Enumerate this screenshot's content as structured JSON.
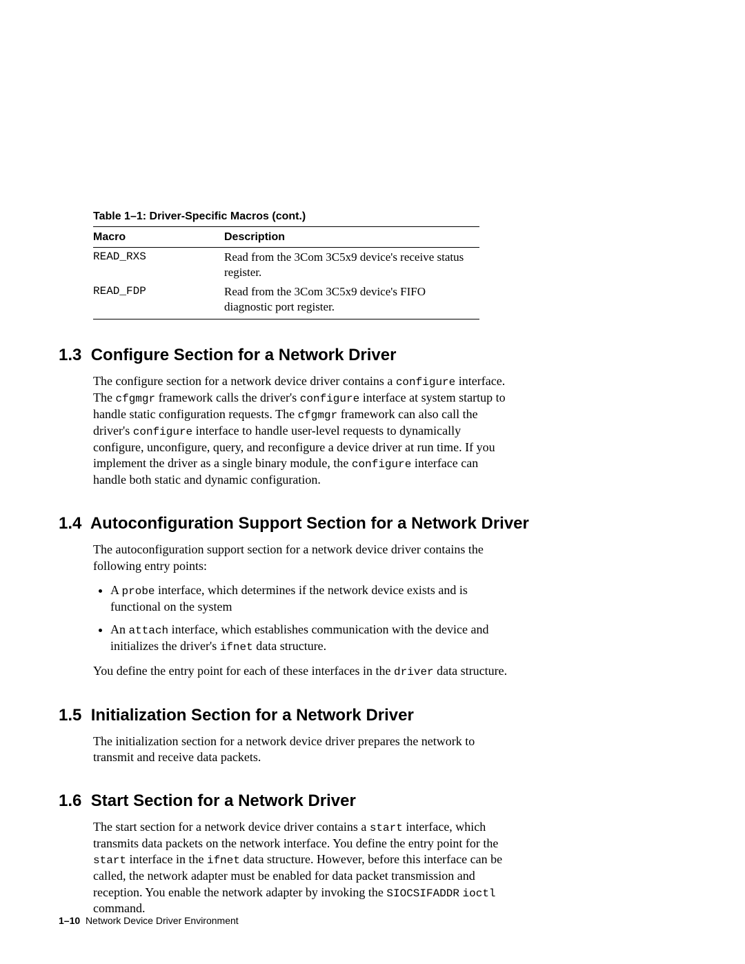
{
  "table": {
    "caption": "Table 1–1: Driver-Specific Macros (cont.)",
    "headers": {
      "c1": "Macro",
      "c2": "Description"
    },
    "rows": [
      {
        "macro": "READ_RXS",
        "desc": "Read from the 3Com 3C5x9 device's receive status register."
      },
      {
        "macro": "READ_FDP",
        "desc": "Read from the 3Com 3C5x9 device's FIFO diagnostic port register."
      }
    ]
  },
  "codes": {
    "configure": "configure",
    "cfgmgr": "cfgmgr",
    "probe": "probe",
    "attach": "attach",
    "ifnet": "ifnet",
    "driver": "driver",
    "start": "start",
    "siocsifaddr": "SIOCSIFADDR",
    "ioctl": "ioctl"
  },
  "sections": {
    "s13": {
      "num": "1.3",
      "title": "Configure Section for a Network Driver",
      "p1a": "The configure section for a network device driver contains a ",
      "p1b": " interface. The ",
      "p1c": " framework calls the driver's ",
      "p1d": " interface at system startup to handle static configuration requests. The ",
      "p1e": " framework can also call the driver's ",
      "p1f": " interface to handle user-level requests to dynamically configure, unconfigure, query, and reconfigure a device driver at run time. If you implement the driver as a single binary module, the ",
      "p1g": " interface can handle both static and dynamic configuration."
    },
    "s14": {
      "num": "1.4",
      "title": "Autoconfiguration Support Section for a Network Driver",
      "p1": "The autoconfiguration support section for a network device driver contains the following entry points:",
      "li1a": "A ",
      "li1b": " interface, which determines if the network device exists and is functional on the system",
      "li2a": "An ",
      "li2b": " interface, which establishes communication with the device and initializes the driver's ",
      "li2c": " data structure.",
      "p2a": "You define the entry point for each of these interfaces in the ",
      "p2b": " data structure."
    },
    "s15": {
      "num": "1.5",
      "title": "Initialization Section for a Network Driver",
      "p1": "The initialization section for a network device driver prepares the network to transmit and receive data packets."
    },
    "s16": {
      "num": "1.6",
      "title": "Start Section for a Network Driver",
      "p1a": "The start section for a network device driver contains a ",
      "p1b": " interface, which transmits data packets on the network interface. You define the entry point for the ",
      "p1c": " interface in the ",
      "p1d": " data structure. However, before this interface can be called, the network adapter must be enabled for data packet transmission and reception. You enable the network adapter by invoking the ",
      "p1e": " ",
      "p1f": " command."
    }
  },
  "footer": {
    "page": "1–10",
    "label": "Network Device Driver Environment"
  }
}
